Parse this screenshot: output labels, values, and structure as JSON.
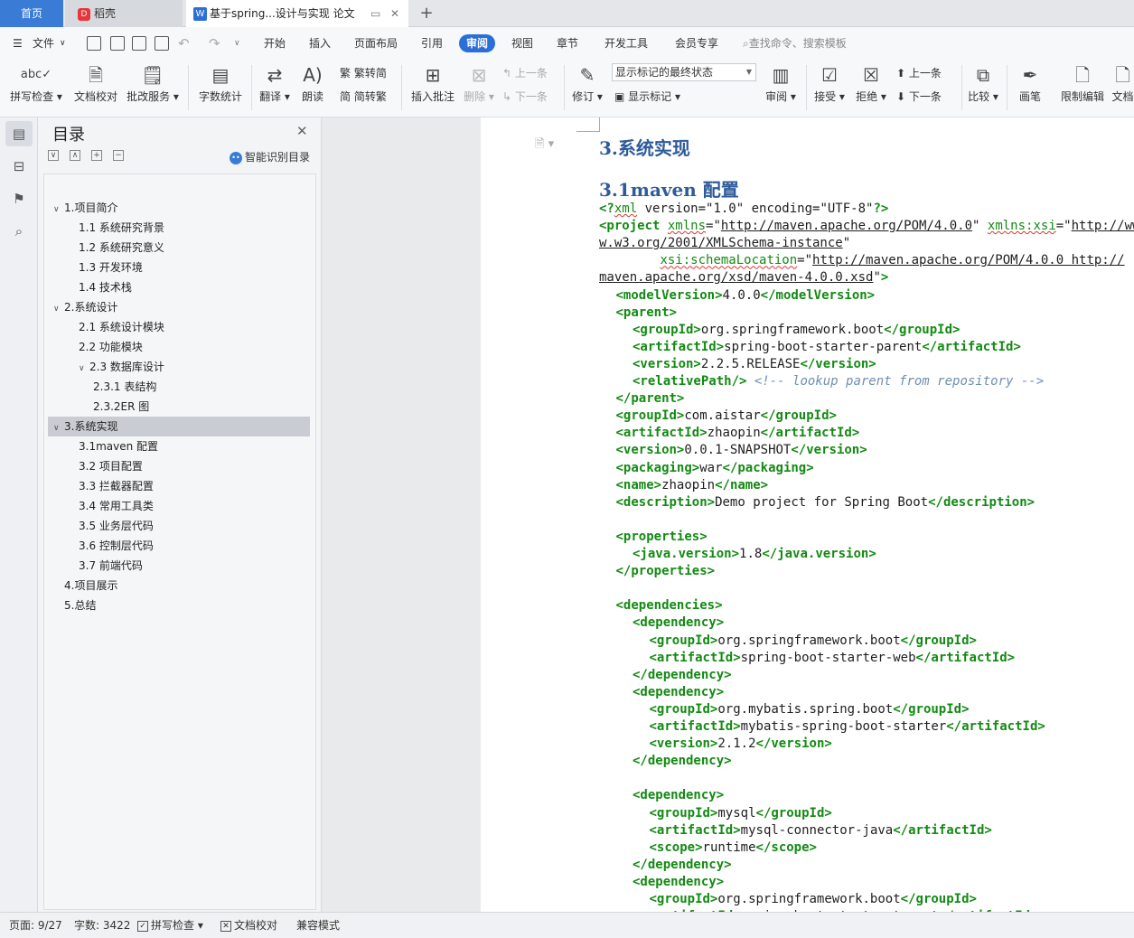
{
  "tabs": {
    "home": "首页",
    "daoke": "稻壳",
    "daoke_icon": "D",
    "doc": "基于spring...设计与实现 论文",
    "doc_icon": "W",
    "add": "+"
  },
  "menu": {
    "file": "文件",
    "items": [
      "开始",
      "插入",
      "页面布局",
      "引用",
      "审阅",
      "视图",
      "章节",
      "开发工具",
      "会员专享"
    ],
    "active": "审阅",
    "search": "查找命令、搜索模板"
  },
  "ribbon": {
    "spell_check": "拼写检查",
    "doc_proof": "文档校对",
    "revise_service": "批改服务",
    "word_count": "字数统计",
    "translate": "翻译",
    "read_aloud": "朗读",
    "trad": "繁转简",
    "simp": "简转繁",
    "insert_comment": "插入批注",
    "delete": "删除",
    "prev_comment": "上一条",
    "next_comment": "下一条",
    "track": "修订",
    "markup_state": "显示标记的最终状态",
    "show_markup": "显示标记",
    "review": "审阅",
    "accept": "接受",
    "reject": "拒绝",
    "prev_change": "上一条",
    "next_change": "下一条",
    "compare": "比较",
    "pen": "画笔",
    "restrict": "限制编辑",
    "doc_more": "文档"
  },
  "outline": {
    "title": "目录",
    "smart": "智能识别目录",
    "items": [
      {
        "label": "1.项目简介",
        "level": 1,
        "caret": "∨"
      },
      {
        "label": "1.1 系统研究背景",
        "level": 2,
        "caret": ""
      },
      {
        "label": "1.2 系统研究意义",
        "level": 2,
        "caret": ""
      },
      {
        "label": "1.3 开发环境",
        "level": 2,
        "caret": ""
      },
      {
        "label": "1.4 技术栈",
        "level": 2,
        "caret": ""
      },
      {
        "label": "2.系统设计",
        "level": 1,
        "caret": "∨"
      },
      {
        "label": "2.1 系统设计模块",
        "level": 2,
        "caret": ""
      },
      {
        "label": "2.2 功能模块",
        "level": 2,
        "caret": ""
      },
      {
        "label": "2.3 数据库设计",
        "level": 2,
        "caret": "∨"
      },
      {
        "label": "2.3.1 表结构",
        "level": 3,
        "caret": ""
      },
      {
        "label": "2.3.2ER 图",
        "level": 3,
        "caret": ""
      },
      {
        "label": "3.系统实现",
        "level": 1,
        "caret": "∨",
        "selected": true
      },
      {
        "label": "3.1maven 配置",
        "level": 2,
        "caret": ""
      },
      {
        "label": "3.2 项目配置",
        "level": 2,
        "caret": ""
      },
      {
        "label": "3.3 拦截器配置",
        "level": 2,
        "caret": ""
      },
      {
        "label": "3.4 常用工具类",
        "level": 2,
        "caret": ""
      },
      {
        "label": "3.5 业务层代码",
        "level": 2,
        "caret": ""
      },
      {
        "label": "3.6 控制层代码",
        "level": 2,
        "caret": ""
      },
      {
        "label": "3.7 前端代码",
        "level": 2,
        "caret": ""
      },
      {
        "label": "4.项目展示",
        "level": 1,
        "caret": ""
      },
      {
        "label": "5.总结",
        "level": 1,
        "caret": ""
      }
    ]
  },
  "document": {
    "heading1": "3.系统实现",
    "heading2": "3.1maven 配置",
    "code": [
      {
        "indent": 0,
        "parts": [
          [
            "tg",
            "<?"
          ],
          [
            "at",
            "xml"
          ],
          [
            "str",
            " version=\"1.0\" encoding=\"UTF-8\""
          ],
          [
            "tg",
            "?>"
          ]
        ]
      },
      {
        "indent": 0,
        "parts": [
          [
            "tg",
            "<project "
          ],
          [
            "at",
            "xmlns"
          ],
          [
            "str",
            "=\""
          ],
          [
            "url",
            "http://maven.apache.org/POM/4.0.0"
          ],
          [
            "str",
            "\" "
          ],
          [
            "at",
            "xmlns:xsi"
          ],
          [
            "str",
            "=\""
          ],
          [
            "url",
            "http://ww"
          ]
        ]
      },
      {
        "indent": 0,
        "parts": [
          [
            "url",
            "w.w3.org/2001/XMLSchema-instance"
          ],
          [
            "str",
            "\""
          ]
        ]
      },
      {
        "indent": 0,
        "parts": [
          [
            "str",
            "        "
          ],
          [
            "at",
            "xsi:schemaLocation"
          ],
          [
            "str",
            "=\""
          ],
          [
            "url",
            "http://maven.apache.org/POM/4.0.0 http://"
          ]
        ]
      },
      {
        "indent": 0,
        "parts": [
          [
            "url",
            "maven.apache.org/xsd/maven-4.0.0.xsd"
          ],
          [
            "str",
            "\""
          ],
          [
            "tg",
            ">"
          ]
        ]
      },
      {
        "indent": 1,
        "parts": [
          [
            "tg",
            "<modelVersion>"
          ],
          [
            "str",
            "4.0.0"
          ],
          [
            "tg",
            "</modelVersion>"
          ]
        ]
      },
      {
        "indent": 1,
        "parts": [
          [
            "tg",
            "<parent>"
          ]
        ]
      },
      {
        "indent": 2,
        "parts": [
          [
            "tg",
            "<groupId>"
          ],
          [
            "str",
            "org.springframework.boot"
          ],
          [
            "tg",
            "</groupId>"
          ]
        ]
      },
      {
        "indent": 2,
        "parts": [
          [
            "tg",
            "<artifactId>"
          ],
          [
            "str",
            "spring-boot-starter-parent"
          ],
          [
            "tg",
            "</artifactId>"
          ]
        ]
      },
      {
        "indent": 2,
        "parts": [
          [
            "tg",
            "<version>"
          ],
          [
            "str",
            "2.2.5.RELEASE"
          ],
          [
            "tg",
            "</version>"
          ]
        ]
      },
      {
        "indent": 2,
        "parts": [
          [
            "tg",
            "<relativePath/>"
          ],
          [
            "cm",
            " <!-- lookup parent from repository -->"
          ]
        ]
      },
      {
        "indent": 1,
        "parts": [
          [
            "tg",
            "</parent>"
          ]
        ]
      },
      {
        "indent": 1,
        "parts": [
          [
            "tg",
            "<groupId>"
          ],
          [
            "str",
            "com.aistar"
          ],
          [
            "tg",
            "</groupId>"
          ]
        ]
      },
      {
        "indent": 1,
        "parts": [
          [
            "tg",
            "<artifactId>"
          ],
          [
            "str",
            "zhaopin"
          ],
          [
            "tg",
            "</artifactId>"
          ]
        ]
      },
      {
        "indent": 1,
        "parts": [
          [
            "tg",
            "<version>"
          ],
          [
            "str",
            "0.0.1-SNAPSHOT"
          ],
          [
            "tg",
            "</version>"
          ]
        ]
      },
      {
        "indent": 1,
        "parts": [
          [
            "tg",
            "<packaging>"
          ],
          [
            "str",
            "war"
          ],
          [
            "tg",
            "</packaging>"
          ]
        ]
      },
      {
        "indent": 1,
        "parts": [
          [
            "tg",
            "<name>"
          ],
          [
            "str",
            "zhaopin"
          ],
          [
            "tg",
            "</name>"
          ]
        ]
      },
      {
        "indent": 1,
        "parts": [
          [
            "tg",
            "<description>"
          ],
          [
            "str",
            "Demo project for Spring Boot"
          ],
          [
            "tg",
            "</description>"
          ]
        ]
      },
      {
        "indent": 0,
        "parts": []
      },
      {
        "indent": 1,
        "parts": [
          [
            "tg",
            "<properties>"
          ]
        ]
      },
      {
        "indent": 2,
        "parts": [
          [
            "tg",
            "<java.version>"
          ],
          [
            "str",
            "1.8"
          ],
          [
            "tg",
            "</java.version>"
          ]
        ]
      },
      {
        "indent": 1,
        "parts": [
          [
            "tg",
            "</properties>"
          ]
        ]
      },
      {
        "indent": 0,
        "parts": []
      },
      {
        "indent": 1,
        "parts": [
          [
            "tg",
            "<dependencies>"
          ]
        ]
      },
      {
        "indent": 2,
        "parts": [
          [
            "tg",
            "<dependency>"
          ]
        ]
      },
      {
        "indent": 3,
        "parts": [
          [
            "tg",
            "<groupId>"
          ],
          [
            "str",
            "org.springframework.boot"
          ],
          [
            "tg",
            "</groupId>"
          ]
        ]
      },
      {
        "indent": 3,
        "parts": [
          [
            "tg",
            "<artifactId>"
          ],
          [
            "str",
            "spring-boot-starter-web"
          ],
          [
            "tg",
            "</artifactId>"
          ]
        ]
      },
      {
        "indent": 2,
        "parts": [
          [
            "tg",
            "</dependency>"
          ]
        ]
      },
      {
        "indent": 2,
        "parts": [
          [
            "tg",
            "<dependency>"
          ]
        ]
      },
      {
        "indent": 3,
        "parts": [
          [
            "tg",
            "<groupId>"
          ],
          [
            "str",
            "org.mybatis.spring.boot"
          ],
          [
            "tg",
            "</groupId>"
          ]
        ]
      },
      {
        "indent": 3,
        "parts": [
          [
            "tg",
            "<artifactId>"
          ],
          [
            "str",
            "mybatis-spring-boot-starter"
          ],
          [
            "tg",
            "</artifactId>"
          ]
        ]
      },
      {
        "indent": 3,
        "parts": [
          [
            "tg",
            "<version>"
          ],
          [
            "str",
            "2.1.2"
          ],
          [
            "tg",
            "</version>"
          ]
        ]
      },
      {
        "indent": 2,
        "parts": [
          [
            "tg",
            "</dependency>"
          ]
        ]
      },
      {
        "indent": 0,
        "parts": []
      },
      {
        "indent": 2,
        "parts": [
          [
            "tg",
            "<dependency>"
          ]
        ]
      },
      {
        "indent": 3,
        "parts": [
          [
            "tg",
            "<groupId>"
          ],
          [
            "str",
            "mysql"
          ],
          [
            "tg",
            "</groupId>"
          ]
        ]
      },
      {
        "indent": 3,
        "parts": [
          [
            "tg",
            "<artifactId>"
          ],
          [
            "str",
            "mysql-connector-java"
          ],
          [
            "tg",
            "</artifactId>"
          ]
        ]
      },
      {
        "indent": 3,
        "parts": [
          [
            "tg",
            "<scope>"
          ],
          [
            "str",
            "runtime"
          ],
          [
            "tg",
            "</scope>"
          ]
        ]
      },
      {
        "indent": 2,
        "parts": [
          [
            "tg",
            "</dependency>"
          ]
        ]
      },
      {
        "indent": 2,
        "parts": [
          [
            "tg",
            "<dependency>"
          ]
        ]
      },
      {
        "indent": 3,
        "parts": [
          [
            "tg",
            "<groupId>"
          ],
          [
            "str",
            "org.springframework.boot"
          ],
          [
            "tg",
            "</groupId>"
          ]
        ]
      },
      {
        "indent": 3,
        "parts": [
          [
            "tg",
            "<artifactId>"
          ],
          [
            "str",
            "spring-boot-starter-tomcat"
          ],
          [
            "tg",
            "</artifactId>"
          ]
        ]
      }
    ]
  },
  "status": {
    "page": "页面: 9/27",
    "words": "字数: 3422",
    "spell": "拼写检查",
    "proof": "文档校对",
    "compat": "兼容模式"
  }
}
